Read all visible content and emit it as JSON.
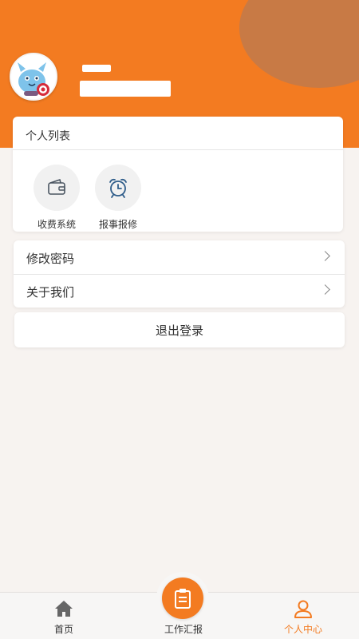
{
  "colors": {
    "accent": "#f37b21",
    "header_circle": "#c87a45",
    "tab_active": "#f37b21",
    "tab_inactive": "#555555",
    "background": "#f7f3f0"
  },
  "profile": {
    "avatar_icon": "cartoon-mascot-avatar",
    "name_redacted": true,
    "id_redacted": true
  },
  "personal_list": {
    "title": "个人列表",
    "items": [
      {
        "label": "收费系统",
        "icon": "wallet-icon"
      },
      {
        "label": "报事报修",
        "icon": "alarm-clock-icon"
      }
    ]
  },
  "menu": {
    "items": [
      {
        "label": "修改密码",
        "icon": "chevron-right-icon"
      },
      {
        "label": "关于我们",
        "icon": "chevron-right-icon"
      }
    ]
  },
  "logout": {
    "label": "退出登录"
  },
  "tabbar": {
    "tabs": [
      {
        "label": "首页",
        "icon": "home-icon",
        "active": false
      },
      {
        "label": "工作汇报",
        "icon": "clipboard-icon",
        "active": false
      },
      {
        "label": "个人中心",
        "icon": "user-icon",
        "active": true
      }
    ]
  }
}
